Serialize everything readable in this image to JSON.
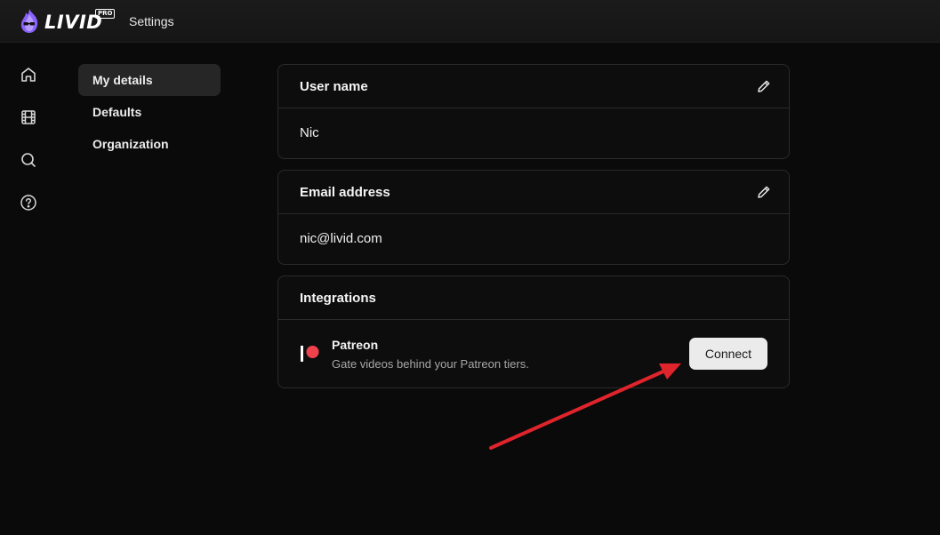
{
  "app": {
    "logo_text": "LIVID",
    "logo_badge": "PRO",
    "title": "Settings"
  },
  "rail": {
    "icons": [
      "home-icon",
      "film-icon",
      "search-icon",
      "help-icon"
    ]
  },
  "subnav": {
    "items": [
      {
        "label": "My details",
        "active": true
      },
      {
        "label": "Defaults",
        "active": false
      },
      {
        "label": "Organization",
        "active": false
      }
    ]
  },
  "username": {
    "title": "User name",
    "value": "Nic"
  },
  "email": {
    "title": "Email address",
    "value": "nic@livid.com"
  },
  "integrations": {
    "title": "Integrations",
    "items": [
      {
        "name": "Patreon",
        "description": "Gate videos behind your Patreon tiers.",
        "action_label": "Connect",
        "brand_color": "#f0424c"
      }
    ]
  },
  "annotation": {
    "type": "arrow",
    "color": "#e0242c"
  }
}
